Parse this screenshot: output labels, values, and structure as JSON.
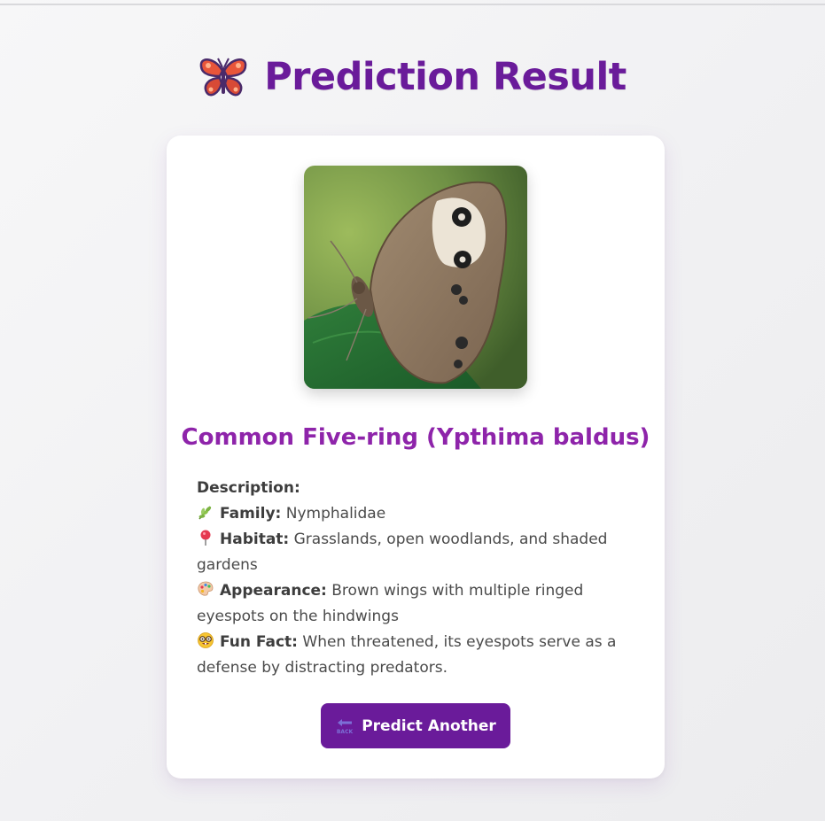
{
  "header": {
    "icon": "butterfly-icon",
    "title": "Prediction Result"
  },
  "result": {
    "image_alt": "butterfly-photo",
    "species": "Common Five-ring (Ypthima baldus)",
    "description_label": "Description:",
    "details": [
      {
        "icon": "herb-icon",
        "label": "Family:",
        "value": " Nymphalidae"
      },
      {
        "icon": "pushpin-icon",
        "label": "Habitat:",
        "value": " Grasslands, open woodlands, and shaded gardens"
      },
      {
        "icon": "palette-icon",
        "label": "Appearance:",
        "value": " Brown wings with multiple ringed eyespots on the hindwings"
      },
      {
        "icon": "nerd-face-icon",
        "label": "Fun Fact:",
        "value": " When threatened, its eyespots serve as a defense by distracting predators."
      }
    ]
  },
  "actions": {
    "back_icon": "back-arrow-icon",
    "predict_another_label": "Predict Another"
  },
  "colors": {
    "accent": "#6a1b9a",
    "species_name": "#8e24aa",
    "card": "#ffffff"
  }
}
